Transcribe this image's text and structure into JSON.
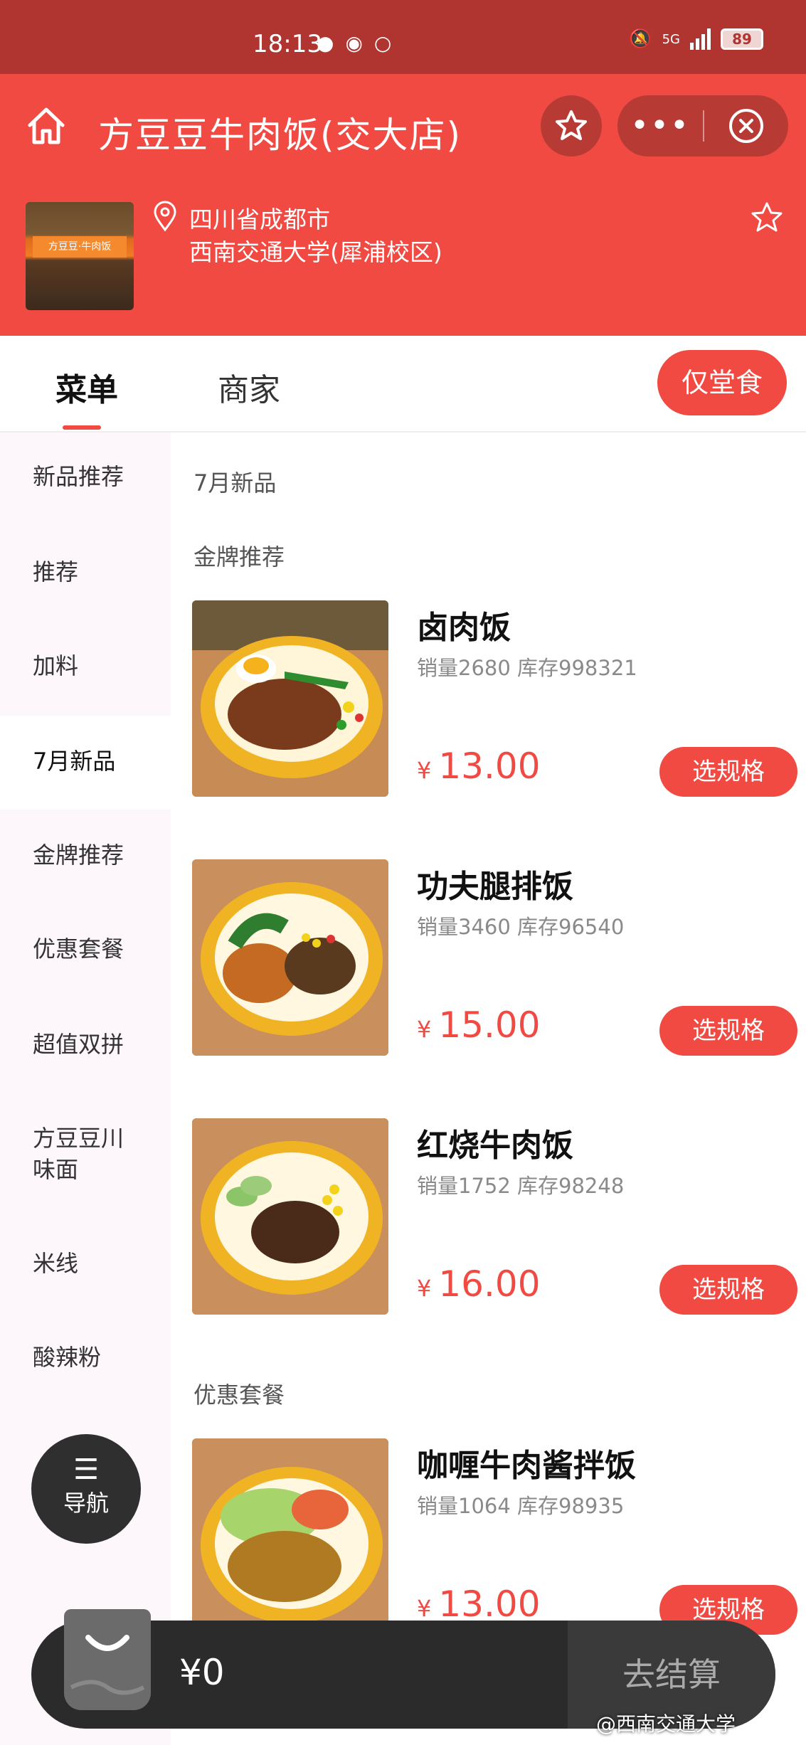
{
  "status_bar": {
    "time": "18:13",
    "network": "5G",
    "battery": "89"
  },
  "navbar": {
    "title": "方豆豆牛肉饭(交大店)"
  },
  "store": {
    "sign_text": "方豆豆·牛肉饭",
    "address_line1": "四川省成都市",
    "address_line2": "西南交通大学(犀浦校区)"
  },
  "tabs": {
    "menu": "菜单",
    "merchant": "商家",
    "dine_in": "仅堂食"
  },
  "sidebar": {
    "items": [
      "新品推荐",
      "推荐",
      "加料",
      "7月新品",
      "金牌推荐",
      "优惠套餐",
      "超值双拼",
      "方豆豆川味面",
      "米线",
      "酸辣粉"
    ],
    "active_index": 3
  },
  "content": {
    "section_july": "7月新品",
    "section_gold": "金牌推荐",
    "section_deal": "优惠套餐",
    "dishes": [
      {
        "name": "卤肉饭",
        "meta": "销量2680 库存998321",
        "currency": "¥",
        "price": "13.00",
        "button": "选规格"
      },
      {
        "name": "功夫腿排饭",
        "meta": "销量3460 库存96540",
        "currency": "¥",
        "price": "15.00",
        "button": "选规格"
      },
      {
        "name": "红烧牛肉饭",
        "meta": "销量1752 库存98248",
        "currency": "¥",
        "price": "16.00",
        "button": "选规格"
      },
      {
        "name": "咖喱牛肉酱拌饭",
        "meta": "销量1064 库存98935",
        "currency": "¥",
        "price": "13.00",
        "button": "选规格"
      }
    ]
  },
  "fab": {
    "label": "导航"
  },
  "cart": {
    "total": "¥0",
    "checkout": "去结算"
  },
  "watermark": "@西南交通大学",
  "colors": {
    "primary": "#f04a43",
    "status_bar": "#b03530",
    "sidebar_bg": "#fdf7fb",
    "cart_bg": "#2b2b2b"
  }
}
